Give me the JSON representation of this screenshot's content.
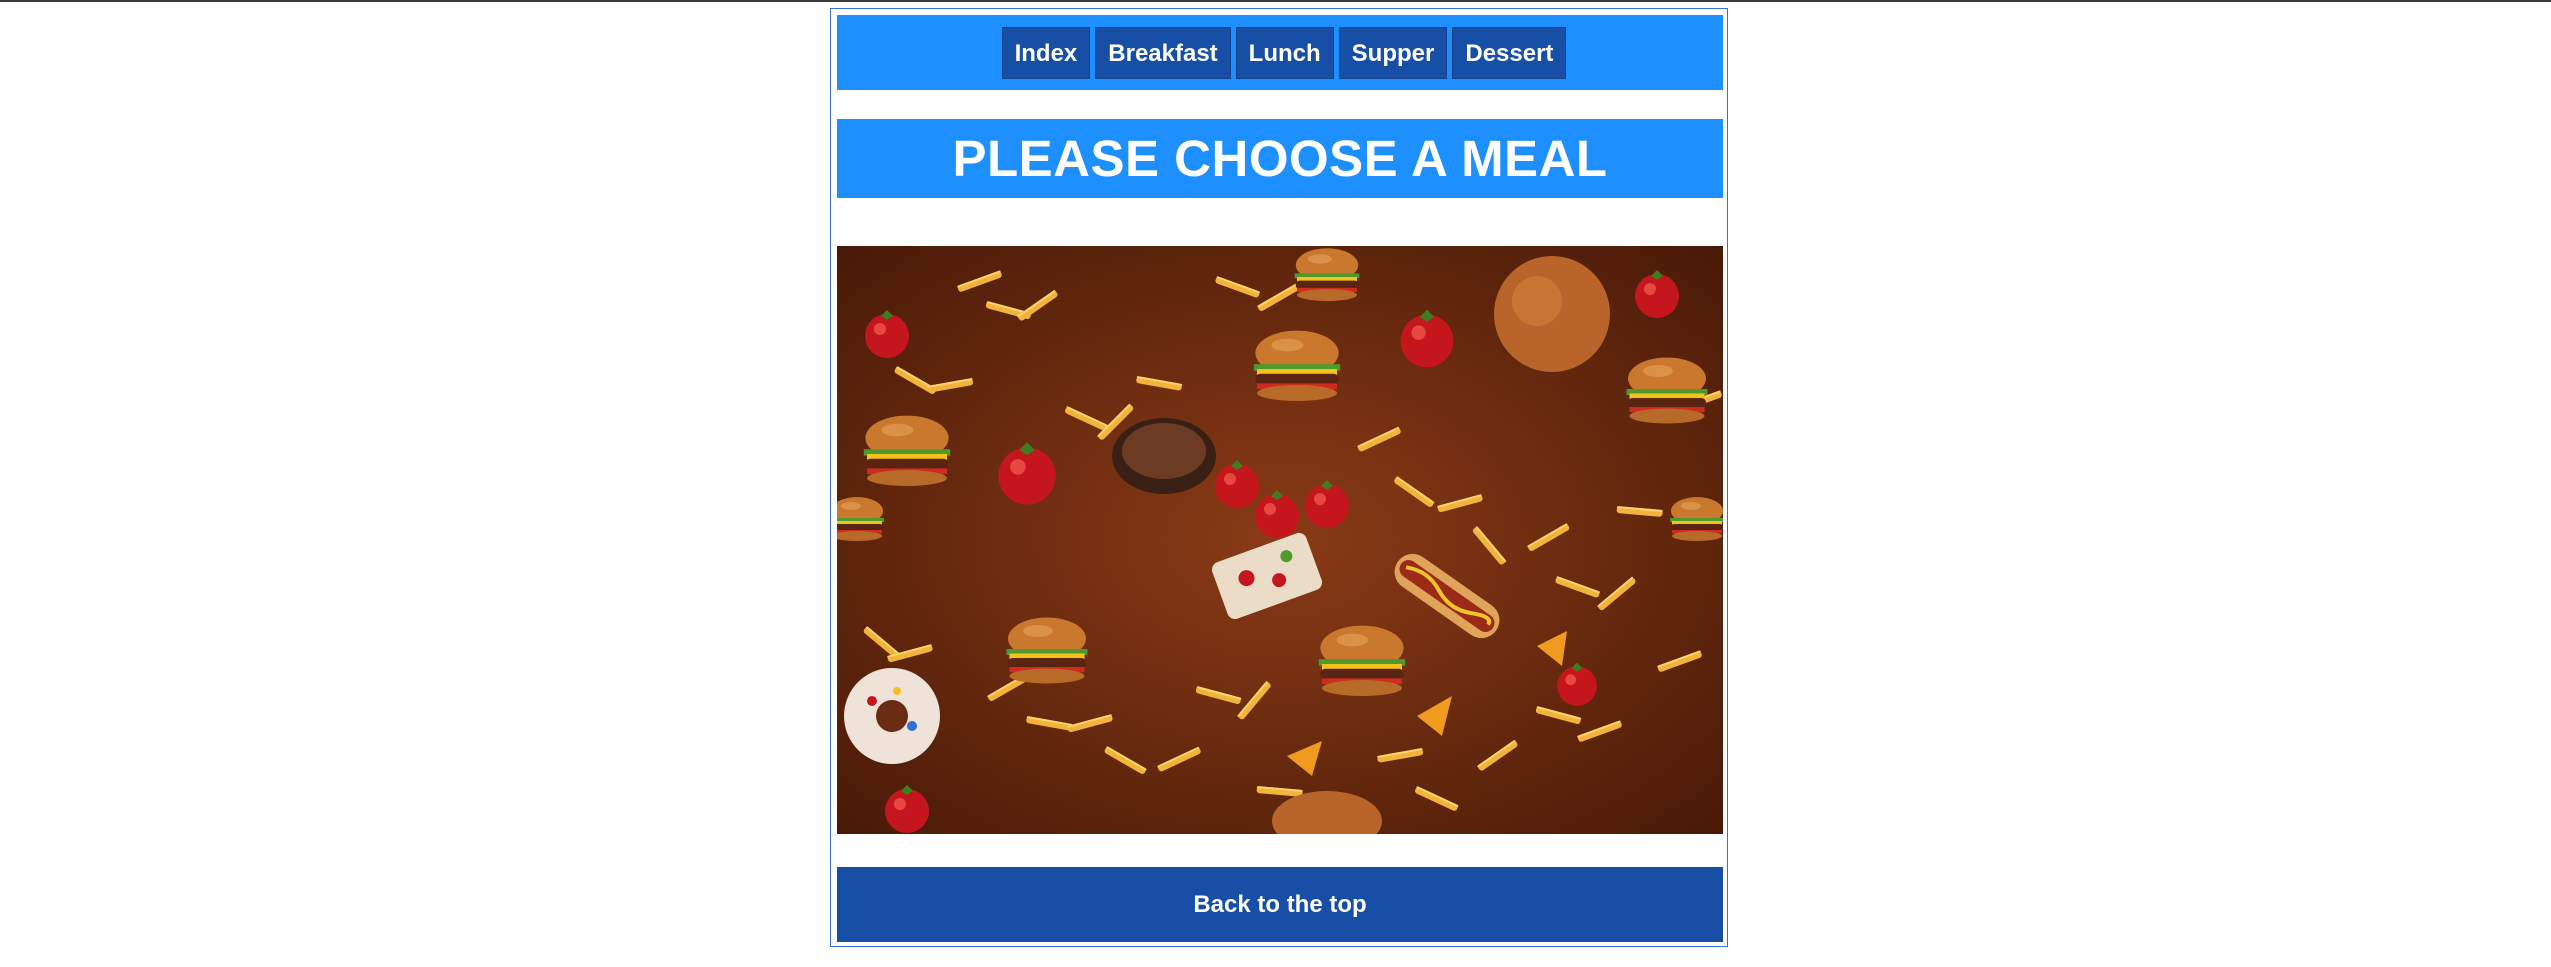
{
  "nav": {
    "items": [
      {
        "label": "Index"
      },
      {
        "label": "Breakfast"
      },
      {
        "label": "Lunch"
      },
      {
        "label": "Supper"
      },
      {
        "label": "Dessert"
      }
    ]
  },
  "main": {
    "title": "PLEASE CHOOSE A MEAL"
  },
  "footer": {
    "back_to_top": "Back to the top"
  },
  "colors": {
    "nav_background": "#1e8fff",
    "nav_button": "#174ea6",
    "title_background": "#1e8fff",
    "footer_background": "#174ea6",
    "text": "#ffffff"
  }
}
